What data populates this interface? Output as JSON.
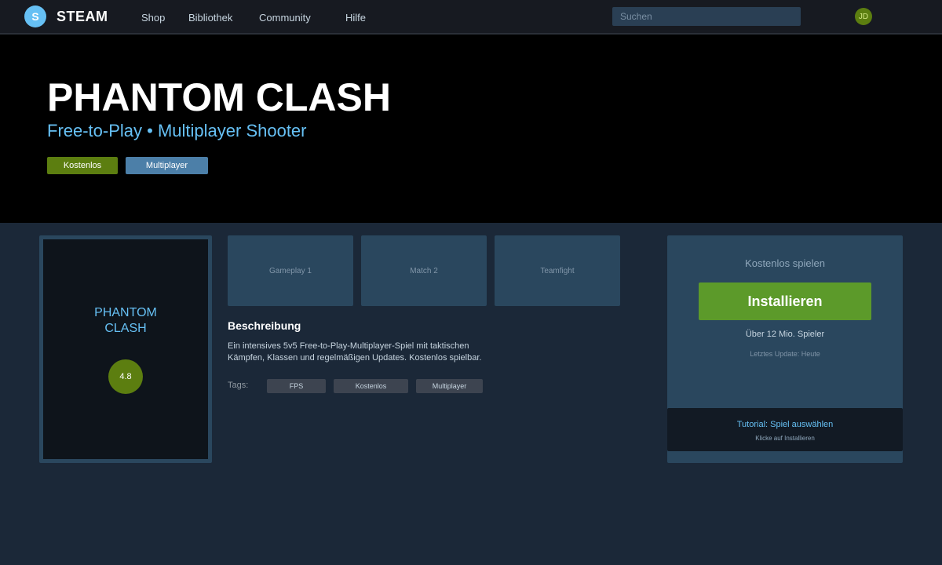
{
  "header": {
    "logo_letter": "S",
    "brand": "STEAM",
    "nav": [
      "Shop",
      "Bibliothek",
      "Community",
      "Hilfe"
    ],
    "search_placeholder": "Suchen",
    "avatar_initials": "JD"
  },
  "hero": {
    "title": "PHANTOM CLASH",
    "subtitle": "Free-to-Play • Multiplayer Shooter",
    "badges": [
      "Kostenlos",
      "Multiplayer"
    ]
  },
  "cover": {
    "title": "PHANTOM\nCLASH",
    "rating": "4.8"
  },
  "screenshots": [
    "Gameplay 1",
    "Match 2",
    "Teamfight"
  ],
  "description": {
    "heading": "Beschreibung",
    "text": "Ein intensives 5v5 Free-to-Play-Multiplayer-Spiel mit taktischen Kämpfen, Klassen und regelmäßigen Updates. Kostenlos spielbar.",
    "tags_label": "Tags:",
    "tags": [
      "FPS",
      "Kostenlos",
      "Multiplayer"
    ]
  },
  "purchase": {
    "label": "Kostenlos spielen",
    "install_label": "Installieren",
    "players": "Über 12 Mio. Spieler",
    "update": "Letztes Update: Heute",
    "tutorial_title": "Tutorial: Spiel auswählen",
    "tutorial_sub": "Klicke auf Installieren"
  },
  "colors": {
    "accent_blue": "#66c0f4",
    "install_green": "#5c9a2a",
    "background": "#1b2838"
  }
}
